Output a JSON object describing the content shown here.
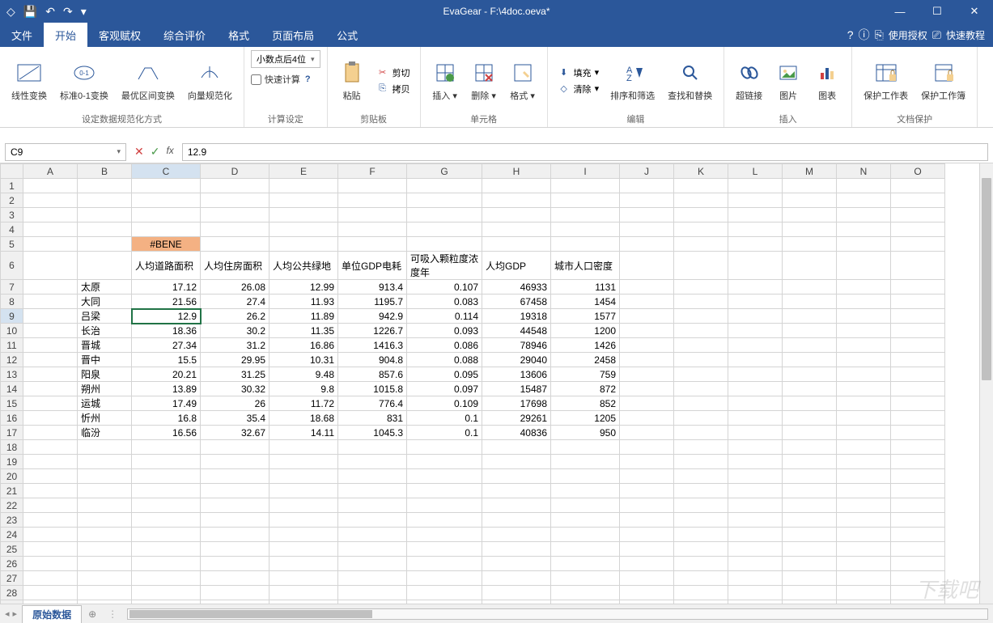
{
  "app_title": "EvaGear  -   F:\\4doc.oeva*",
  "qat": {
    "logo": "◇",
    "save": "💾",
    "undo": "↶",
    "redo": "↷",
    "custom": "▾"
  },
  "win": {
    "min": "—",
    "max": "☐",
    "close": "✕"
  },
  "menu": {
    "tabs": [
      "文件",
      "开始",
      "客观赋权",
      "综合评价",
      "格式",
      "页面布局",
      "公式"
    ],
    "active_idx": 1,
    "help": "?",
    "info": "ⓘ",
    "auth_icon": "⎘",
    "auth": "使用授权",
    "tut_icon": "⎚",
    "tutorial": "快速教程"
  },
  "ribbon": {
    "g1": {
      "linear": "线性变换",
      "std01": "标准0-1变换",
      "optimal": "最优区间变换",
      "vector": "向量规范化",
      "label": "设定数据规范化方式"
    },
    "g2": {
      "decimals": "小数点后4位",
      "fastcalc": "快速计算",
      "label": "计算设定"
    },
    "g3": {
      "paste": "粘贴",
      "cut": "剪切",
      "copy": "拷贝",
      "label": "剪贴板"
    },
    "g4": {
      "insert": "插入",
      "delete": "删除",
      "format": "格式",
      "label": "单元格"
    },
    "g5": {
      "fill": "填充",
      "clear": "清除",
      "sortfilter": "排序和筛选",
      "findrepl": "查找和替换",
      "label": "编辑"
    },
    "g6": {
      "hyperlink": "超链接",
      "picture": "图片",
      "chart": "图表",
      "label": "插入"
    },
    "g7": {
      "protect_sheet": "保护工作表",
      "protect_book": "保护工作簿",
      "label": "文档保护"
    }
  },
  "fbar": {
    "cell": "C9",
    "formula": "12.9",
    "fx": "fx"
  },
  "cols": [
    "A",
    "B",
    "C",
    "D",
    "E",
    "F",
    "G",
    "H",
    "I",
    "J",
    "K",
    "L",
    "M",
    "N",
    "O"
  ],
  "sel_col_idx": 2,
  "sel_row": 9,
  "bene": "#BENE",
  "headers": {
    "C": "人均道路面积",
    "D": "人均住房面积",
    "E": "人均公共绿地",
    "F": "单位GDP电耗",
    "G": "可吸入颗粒度浓度年",
    "H": "人均GDP",
    "I": "城市人口密度"
  },
  "rows": [
    {
      "r": 7,
      "B": "太原",
      "C": "17.12",
      "D": "26.08",
      "E": "12.99",
      "F": "913.4",
      "G": "0.107",
      "H": "46933",
      "I": "1131"
    },
    {
      "r": 8,
      "B": "大同",
      "C": "21.56",
      "D": "27.4",
      "E": "11.93",
      "F": "1195.7",
      "G": "0.083",
      "H": "67458",
      "I": "1454"
    },
    {
      "r": 9,
      "B": "吕梁",
      "C": "12.9",
      "D": "26.2",
      "E": "11.89",
      "F": "942.9",
      "G": "0.114",
      "H": "19318",
      "I": "1577"
    },
    {
      "r": 10,
      "B": "长治",
      "C": "18.36",
      "D": "30.2",
      "E": "11.35",
      "F": "1226.7",
      "G": "0.093",
      "H": "44548",
      "I": "1200"
    },
    {
      "r": 11,
      "B": "晋城",
      "C": "27.34",
      "D": "31.2",
      "E": "16.86",
      "F": "1416.3",
      "G": "0.086",
      "H": "78946",
      "I": "1426"
    },
    {
      "r": 12,
      "B": "晋中",
      "C": "15.5",
      "D": "29.95",
      "E": "10.31",
      "F": "904.8",
      "G": "0.088",
      "H": "29040",
      "I": "2458"
    },
    {
      "r": 13,
      "B": "阳泉",
      "C": "20.21",
      "D": "31.25",
      "E": "9.48",
      "F": "857.6",
      "G": "0.095",
      "H": "13606",
      "I": "759"
    },
    {
      "r": 14,
      "B": "朔州",
      "C": "13.89",
      "D": "30.32",
      "E": "9.8",
      "F": "1015.8",
      "G": "0.097",
      "H": "15487",
      "I": "872"
    },
    {
      "r": 15,
      "B": "运城",
      "C": "17.49",
      "D": "26",
      "E": "11.72",
      "F": "776.4",
      "G": "0.109",
      "H": "17698",
      "I": "852"
    },
    {
      "r": 16,
      "B": "忻州",
      "C": "16.8",
      "D": "35.4",
      "E": "18.68",
      "F": "831",
      "G": "0.1",
      "H": "29261",
      "I": "1205"
    },
    {
      "r": 17,
      "B": "临汾",
      "C": "16.56",
      "D": "32.67",
      "E": "14.11",
      "F": "1045.3",
      "G": "0.1",
      "H": "40836",
      "I": "950"
    }
  ],
  "max_row": 29,
  "sheet_tab": "原始数据",
  "watermark": "下载吧"
}
